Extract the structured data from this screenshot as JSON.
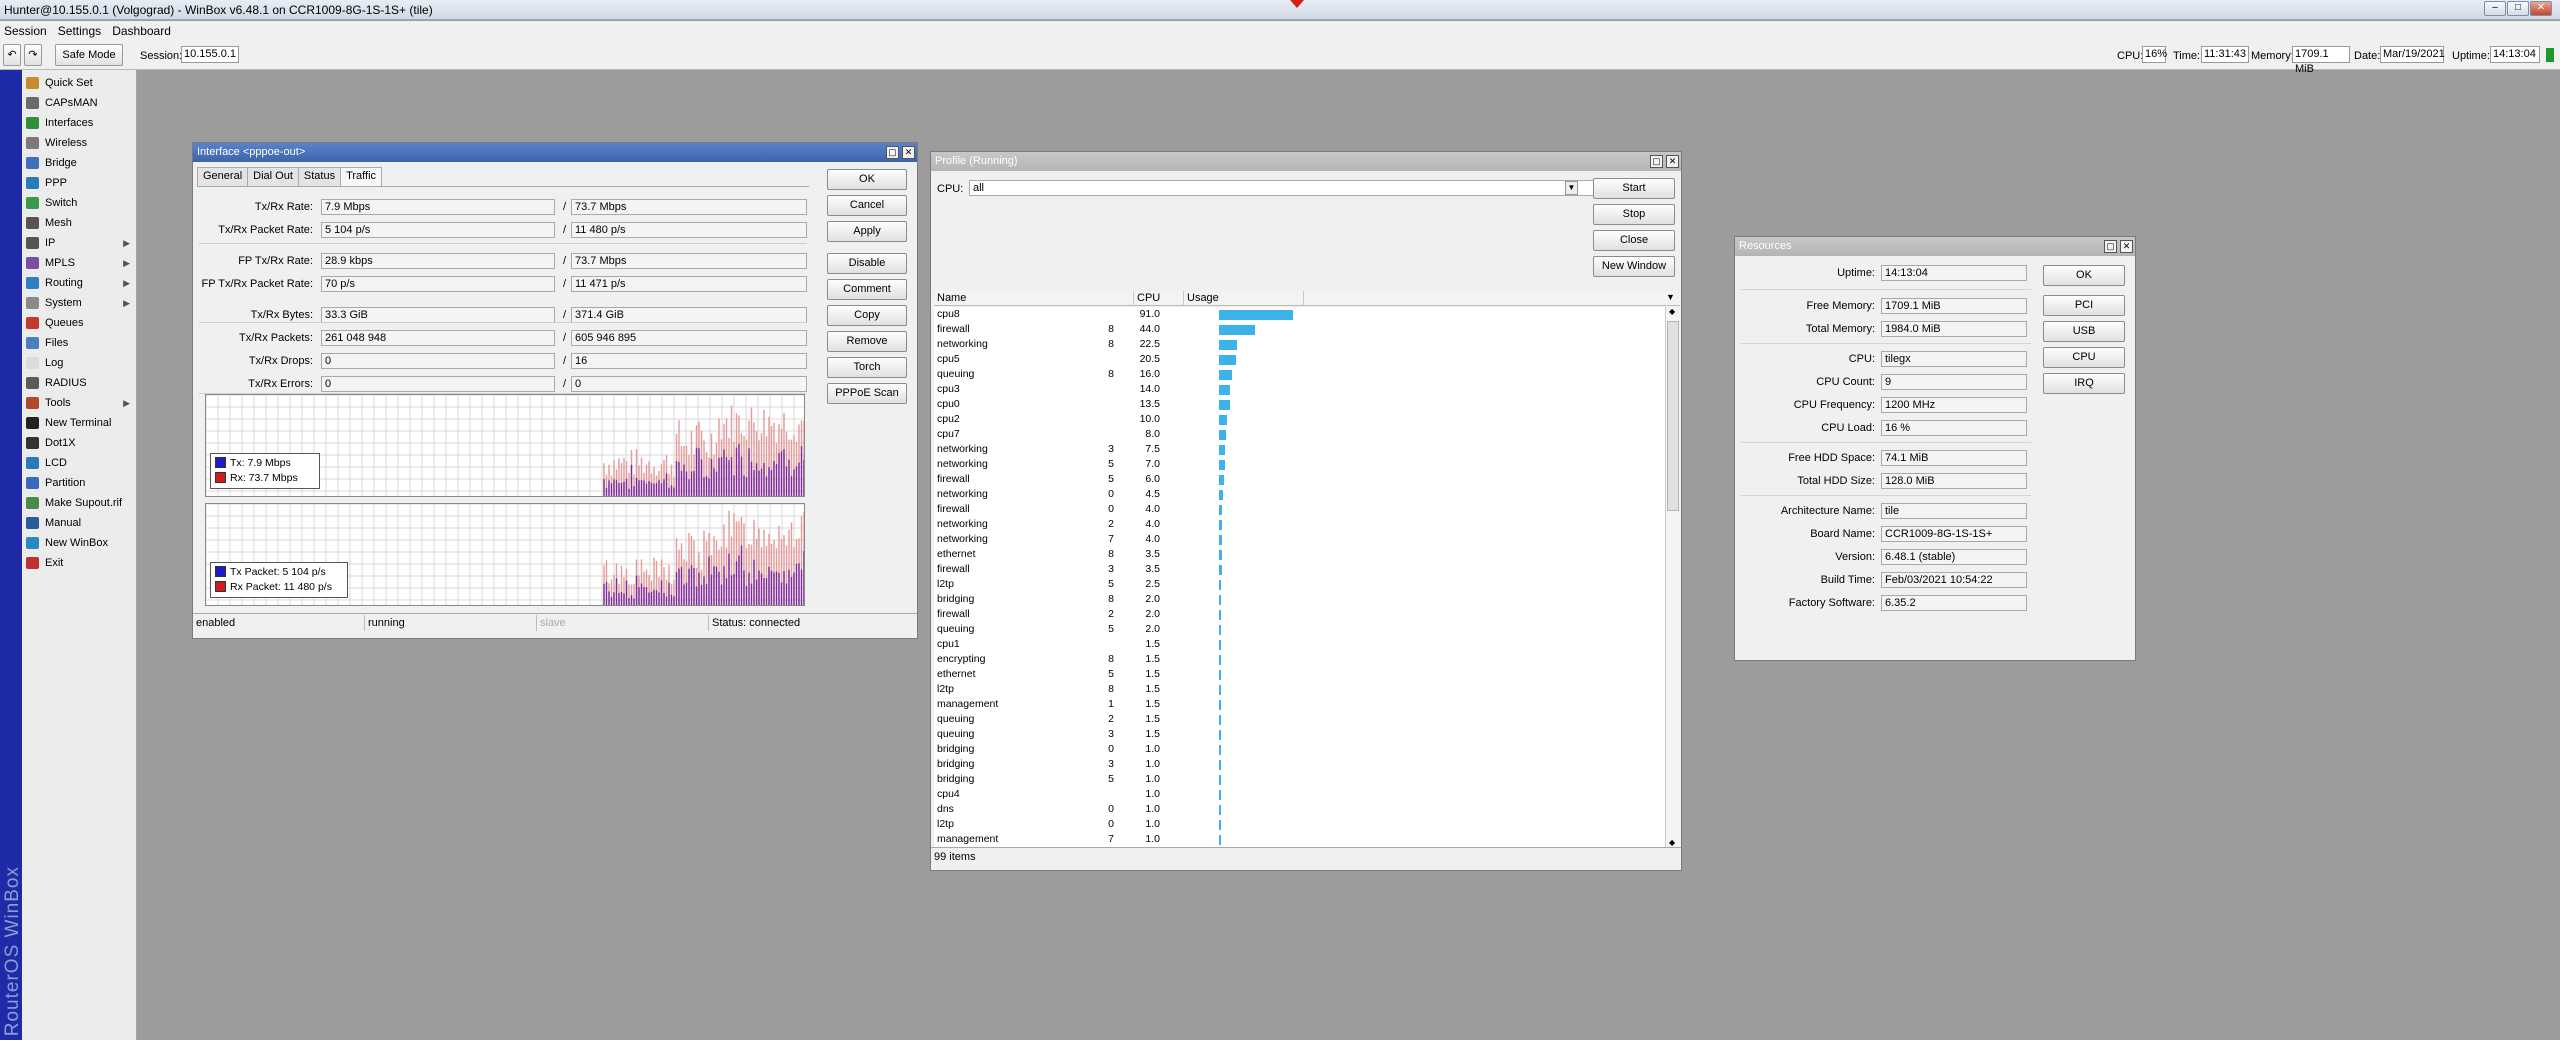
{
  "app": {
    "title": "Hunter@10.155.0.1 (Volgograd) - WinBox v6.48.1 on CCR1009-8G-1S-1S+ (tile)",
    "menu": [
      "Session",
      "Settings",
      "Dashboard"
    ],
    "brand_strip": "RouterOS WinBox"
  },
  "toolbar": {
    "undo_glyph": "↶",
    "redo_glyph": "↷",
    "safe_mode": "Safe Mode",
    "session_label": "Session:",
    "session_value": "10.155.0.1",
    "cpu_label": "CPU:",
    "cpu_value": "16%",
    "time_label": "Time:",
    "time_value": "11:31:43",
    "memory_label": "Memory:",
    "memory_value": "1709.1 MiB",
    "date_label": "Date:",
    "date_value": "Mar/19/2021",
    "uptime_label": "Uptime:",
    "uptime_value": "14:13:04"
  },
  "sidebar": {
    "items": [
      {
        "label": "Quick Set",
        "icon": "quickset-icon",
        "color": "#c98a2b",
        "arrow": false
      },
      {
        "label": "CAPsMAN",
        "icon": "capsman-icon",
        "color": "#6a6a6a",
        "arrow": false
      },
      {
        "label": "Interfaces",
        "icon": "interfaces-icon",
        "color": "#2f8f3a",
        "arrow": false
      },
      {
        "label": "Wireless",
        "icon": "wireless-icon",
        "color": "#7a7a7a",
        "arrow": false
      },
      {
        "label": "Bridge",
        "icon": "bridge-icon",
        "color": "#3f6fbf",
        "arrow": false
      },
      {
        "label": "PPP",
        "icon": "ppp-icon",
        "color": "#2a7ab8",
        "arrow": false
      },
      {
        "label": "Switch",
        "icon": "switch-icon",
        "color": "#3a9a4a",
        "arrow": false
      },
      {
        "label": "Mesh",
        "icon": "mesh-icon",
        "color": "#555555",
        "arrow": false
      },
      {
        "label": "IP",
        "icon": "ip-icon",
        "color": "#555555",
        "arrow": true
      },
      {
        "label": "MPLS",
        "icon": "mpls-icon",
        "color": "#7b4fa0",
        "arrow": true
      },
      {
        "label": "Routing",
        "icon": "routing-icon",
        "color": "#2e7fc4",
        "arrow": true
      },
      {
        "label": "System",
        "icon": "system-icon",
        "color": "#8a8a8a",
        "arrow": true
      },
      {
        "label": "Queues",
        "icon": "queues-icon",
        "color": "#c23a2a",
        "arrow": false
      },
      {
        "label": "Files",
        "icon": "files-icon",
        "color": "#4a7fc0",
        "arrow": false
      },
      {
        "label": "Log",
        "icon": "log-icon",
        "color": "#dcdcdc",
        "arrow": false
      },
      {
        "label": "RADIUS",
        "icon": "radius-icon",
        "color": "#5a5a5a",
        "arrow": false
      },
      {
        "label": "Tools",
        "icon": "tools-icon",
        "color": "#b04a2a",
        "arrow": true
      },
      {
        "label": "New Terminal",
        "icon": "terminal-icon",
        "color": "#222222",
        "arrow": false
      },
      {
        "label": "Dot1X",
        "icon": "dot1x-icon",
        "color": "#333333",
        "arrow": false
      },
      {
        "label": "LCD",
        "icon": "lcd-icon",
        "color": "#2a7ab8",
        "arrow": false
      },
      {
        "label": "Partition",
        "icon": "partition-icon",
        "color": "#3a6ac0",
        "arrow": false
      },
      {
        "label": "Make Supout.rif",
        "icon": "supout-icon",
        "color": "#4a8a4a",
        "arrow": false
      },
      {
        "label": "Manual",
        "icon": "manual-icon",
        "color": "#2a5a9a",
        "arrow": false
      },
      {
        "label": "New WinBox",
        "icon": "winbox-icon",
        "color": "#2a8ac0",
        "arrow": false
      },
      {
        "label": "Exit",
        "icon": "exit-icon",
        "color": "#c03030",
        "arrow": false
      }
    ]
  },
  "interface_window": {
    "title": "Interface <pppoe-out>",
    "tabs": [
      "General",
      "Dial Out",
      "Status",
      "Traffic"
    ],
    "active_tab": "Traffic",
    "fields": [
      {
        "label": "Tx/Rx Rate:",
        "tx": "7.9 Mbps",
        "rx": "73.7 Mbps"
      },
      {
        "label": "Tx/Rx Packet Rate:",
        "tx": "5 104 p/s",
        "rx": "11 480 p/s"
      },
      {
        "label": "FP Tx/Rx Rate:",
        "tx": "28.9 kbps",
        "rx": "73.7 Mbps"
      },
      {
        "label": "FP Tx/Rx Packet Rate:",
        "tx": "70 p/s",
        "rx": "11 471 p/s"
      },
      {
        "label": "Tx/Rx Bytes:",
        "tx": "33.3 GiB",
        "rx": "371.4 GiB"
      },
      {
        "label": "Tx/Rx Packets:",
        "tx": "261 048 948",
        "rx": "605 946 895"
      },
      {
        "label": "Tx/Rx Drops:",
        "tx": "0",
        "rx": "16"
      },
      {
        "label": "Tx/Rx Errors:",
        "tx": "0",
        "rx": "0"
      }
    ],
    "slash": "/",
    "buttons": [
      "OK",
      "Cancel",
      "Apply",
      "Disable",
      "Comment",
      "Copy",
      "Remove",
      "Torch",
      "PPPoE Scan"
    ],
    "graph1_legend": {
      "tx": "Tx:  7.9 Mbps",
      "rx": "Rx:  73.7 Mbps"
    },
    "graph2_legend": {
      "tx": "Tx Packet:  5 104 p/s",
      "rx": "Rx Packet:  11 480 p/s"
    },
    "tx_color": "#1c1cc8",
    "rx_color": "#d01c1c",
    "status": [
      "enabled",
      "running",
      "slave",
      "Status: connected"
    ]
  },
  "profile_window": {
    "title": "Profile (Running)",
    "cpu_label": "CPU:",
    "cpu_value": "all",
    "buttons": [
      "Start",
      "Stop",
      "Close",
      "New Window"
    ],
    "columns": [
      "Name",
      "CPU",
      "Usage"
    ],
    "rows": [
      {
        "name": "cpu8",
        "cpu": "",
        "usage": "91.0"
      },
      {
        "name": "firewall",
        "cpu": "8",
        "usage": "44.0"
      },
      {
        "name": "networking",
        "cpu": "8",
        "usage": "22.5"
      },
      {
        "name": "cpu5",
        "cpu": "",
        "usage": "20.5"
      },
      {
        "name": "queuing",
        "cpu": "8",
        "usage": "16.0"
      },
      {
        "name": "cpu3",
        "cpu": "",
        "usage": "14.0"
      },
      {
        "name": "cpu0",
        "cpu": "",
        "usage": "13.5"
      },
      {
        "name": "cpu2",
        "cpu": "",
        "usage": "10.0"
      },
      {
        "name": "cpu7",
        "cpu": "",
        "usage": "8.0"
      },
      {
        "name": "networking",
        "cpu": "3",
        "usage": "7.5"
      },
      {
        "name": "networking",
        "cpu": "5",
        "usage": "7.0"
      },
      {
        "name": "firewall",
        "cpu": "5",
        "usage": "6.0"
      },
      {
        "name": "networking",
        "cpu": "0",
        "usage": "4.5"
      },
      {
        "name": "firewall",
        "cpu": "0",
        "usage": "4.0"
      },
      {
        "name": "networking",
        "cpu": "2",
        "usage": "4.0"
      },
      {
        "name": "networking",
        "cpu": "7",
        "usage": "4.0"
      },
      {
        "name": "ethernet",
        "cpu": "8",
        "usage": "3.5"
      },
      {
        "name": "firewall",
        "cpu": "3",
        "usage": "3.5"
      },
      {
        "name": "l2tp",
        "cpu": "5",
        "usage": "2.5"
      },
      {
        "name": "bridging",
        "cpu": "8",
        "usage": "2.0"
      },
      {
        "name": "firewall",
        "cpu": "2",
        "usage": "2.0"
      },
      {
        "name": "queuing",
        "cpu": "5",
        "usage": "2.0"
      },
      {
        "name": "cpu1",
        "cpu": "",
        "usage": "1.5"
      },
      {
        "name": "encrypting",
        "cpu": "8",
        "usage": "1.5"
      },
      {
        "name": "ethernet",
        "cpu": "5",
        "usage": "1.5"
      },
      {
        "name": "l2tp",
        "cpu": "8",
        "usage": "1.5"
      },
      {
        "name": "management",
        "cpu": "1",
        "usage": "1.5"
      },
      {
        "name": "queuing",
        "cpu": "2",
        "usage": "1.5"
      },
      {
        "name": "queuing",
        "cpu": "3",
        "usage": "1.5"
      },
      {
        "name": "bridging",
        "cpu": "0",
        "usage": "1.0"
      },
      {
        "name": "bridging",
        "cpu": "3",
        "usage": "1.0"
      },
      {
        "name": "bridging",
        "cpu": "5",
        "usage": "1.0"
      },
      {
        "name": "cpu4",
        "cpu": "",
        "usage": "1.0"
      },
      {
        "name": "dns",
        "cpu": "0",
        "usage": "1.0"
      },
      {
        "name": "l2tp",
        "cpu": "0",
        "usage": "1.0"
      },
      {
        "name": "management",
        "cpu": "7",
        "usage": "1.0"
      }
    ],
    "item_count": "99 items",
    "bar_color": "#3cb1ea"
  },
  "resources_window": {
    "title": "Resources",
    "fields": [
      {
        "label": "Uptime:",
        "value": "14:13:04"
      },
      {
        "label": "Free Memory:",
        "value": "1709.1 MiB"
      },
      {
        "label": "Total Memory:",
        "value": "1984.0 MiB"
      },
      {
        "label": "CPU:",
        "value": "tilegx"
      },
      {
        "label": "CPU Count:",
        "value": "9"
      },
      {
        "label": "CPU Frequency:",
        "value": "1200 MHz"
      },
      {
        "label": "CPU Load:",
        "value": "16 %"
      },
      {
        "label": "Free HDD Space:",
        "value": "74.1 MiB"
      },
      {
        "label": "Total HDD Size:",
        "value": "128.0 MiB"
      },
      {
        "label": "Architecture Name:",
        "value": "tile"
      },
      {
        "label": "Board Name:",
        "value": "CCR1009-8G-1S-1S+"
      },
      {
        "label": "Version:",
        "value": "6.48.1 (stable)"
      },
      {
        "label": "Build Time:",
        "value": "Feb/03/2021 10:54:22"
      },
      {
        "label": "Factory Software:",
        "value": "6.35.2"
      }
    ],
    "buttons": [
      "OK",
      "PCI",
      "USB",
      "CPU",
      "IRQ"
    ]
  }
}
